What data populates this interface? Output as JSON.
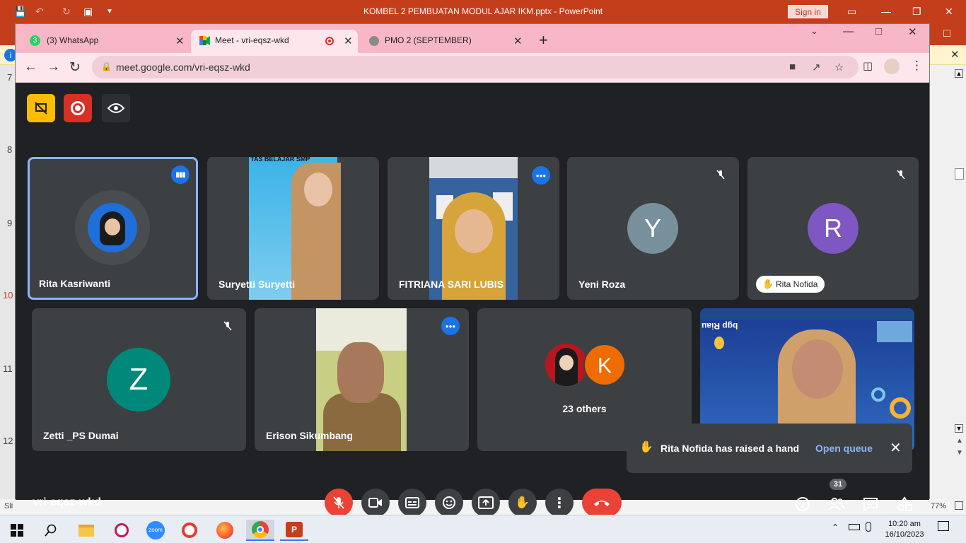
{
  "powerpoint": {
    "title": "KOMBEL 2 PEMBUATAN MODUL AJAR IKM.pptx  -  PowerPoint",
    "sign_in": "Sign in",
    "ruler_numbers": [
      "7",
      "8",
      "9",
      "10",
      "11",
      "12"
    ],
    "status_left": "Sli",
    "zoom": "77%"
  },
  "browser": {
    "tabs": [
      {
        "label": "(3) WhatsApp",
        "badge": "3"
      },
      {
        "label": "Meet - vri-eqsz-wkd"
      },
      {
        "label": "PMO 2 (SEPTEMBER)"
      }
    ],
    "url": "meet.google.com/vri-eqsz-wkd"
  },
  "meet": {
    "code": "vri-eqsz-wkd",
    "participants_count": "31",
    "tiles_row1": [
      {
        "name": "Rita Kasriwanti"
      },
      {
        "name": "Suryetti Suryetti"
      },
      {
        "name": "FITRIANA SARI LUBIS"
      },
      {
        "name": "Yeni Roza",
        "initial": "Y"
      },
      {
        "name": "",
        "initial": "R",
        "raised": "Rita Nofida"
      }
    ],
    "tiles_row2": [
      {
        "name": "Zetti _PS Dumai",
        "initial": "Z"
      },
      {
        "name": "Erison Sikumbang"
      },
      {
        "name": "23 others",
        "initial": "K"
      },
      {
        "name": ""
      }
    ],
    "video_text": {
      "suryetti_banner": "TAS BELAJAR SMP",
      "presentation_logo": "bgp Riau"
    },
    "toast": {
      "message": "Rita Nofida has raised a hand",
      "action": "Open queue"
    }
  },
  "taskbar": {
    "time": "10:20 am",
    "date": "16/10/2023",
    "zoom_label": "zoom"
  },
  "colors": {
    "powerpoint_red": "#c43e1c",
    "chrome_pink": "#f7b7c6",
    "meet_bg": "#202124",
    "tile_bg": "#3c4043",
    "meet_blue": "#1a73e8",
    "end_call_red": "#ea4335",
    "avatar_y": "#78909c",
    "avatar_r": "#7e57c2",
    "avatar_z": "#00897b",
    "avatar_k": "#ef6c00"
  }
}
